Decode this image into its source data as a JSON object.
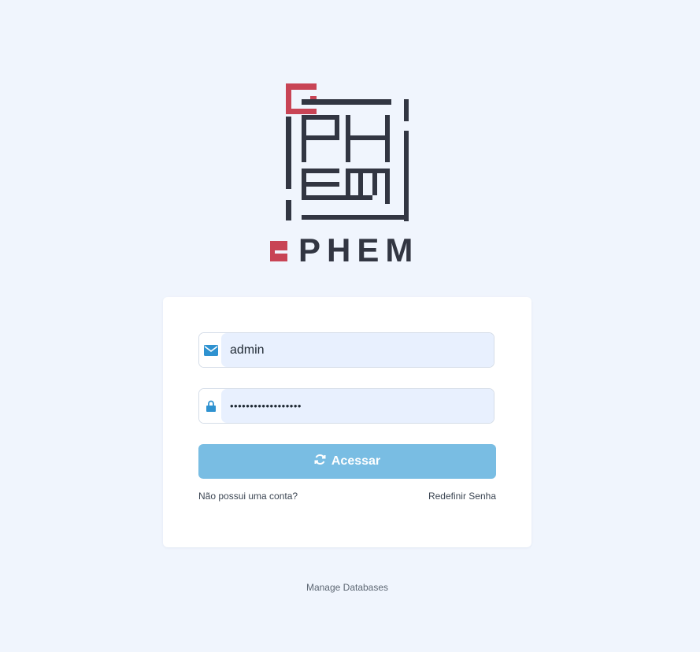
{
  "logo": {
    "wordmark_prefix": "e",
    "wordmark": "PHEM",
    "brand_colors": {
      "accent_red": "#c84455",
      "dark": "#323642"
    }
  },
  "login_form": {
    "email_field": {
      "icon": "envelope-icon",
      "value": "admin"
    },
    "password_field": {
      "icon": "lock-icon",
      "value": "••••••••••••••••••"
    },
    "submit_button": {
      "icon": "refresh-icon",
      "label": "Acessar",
      "color": "#79bde3"
    },
    "signup_link": "Não possui uma conta?",
    "reset_password_link": "Redefinir Senha"
  },
  "footer": {
    "manage_databases_link": "Manage Databases"
  },
  "colors": {
    "page_background": "#f0f5fd",
    "input_background": "#e8f0fe",
    "icon_blue": "#2f92d0"
  }
}
